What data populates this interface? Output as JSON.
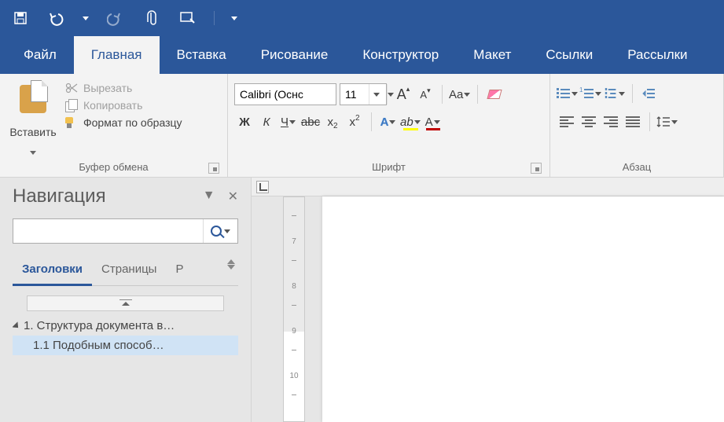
{
  "qat": {
    "save": "save",
    "undo": "undo",
    "redo": "redo",
    "attach": "attach",
    "touch": "touch"
  },
  "tabs": {
    "file": "Файл",
    "home": "Главная",
    "insert": "Вставка",
    "draw": "Рисование",
    "design": "Конструктор",
    "layout": "Макет",
    "references": "Ссылки",
    "mailings": "Рассылки"
  },
  "clipboard": {
    "paste": "Вставить",
    "cut": "Вырезать",
    "copy": "Копировать",
    "format_painter": "Формат по образцу",
    "group": "Буфер обмена"
  },
  "font": {
    "name_value": "Calibri (Оснс",
    "size_value": "11",
    "group": "Шрифт",
    "grow": "A",
    "shrink": "A",
    "case": "Aa",
    "clear": "clear",
    "bold": "Ж",
    "italic": "К",
    "underline": "Ч",
    "strike": "abc",
    "x2": "x",
    "x2sup": "x",
    "texteffects": "A",
    "highlight": "ab",
    "color": "A",
    "highlight_color": "#ffff00",
    "font_color": "#c00000"
  },
  "para": {
    "group": "Абзац"
  },
  "nav": {
    "title": "Навигация",
    "search_placeholder": "",
    "tab_headings": "Заголовки",
    "tab_pages": "Страницы",
    "tab_results_cut": "Р",
    "item1": "1. Структура документа в…",
    "item2": "1.1 Подобным способ…"
  }
}
